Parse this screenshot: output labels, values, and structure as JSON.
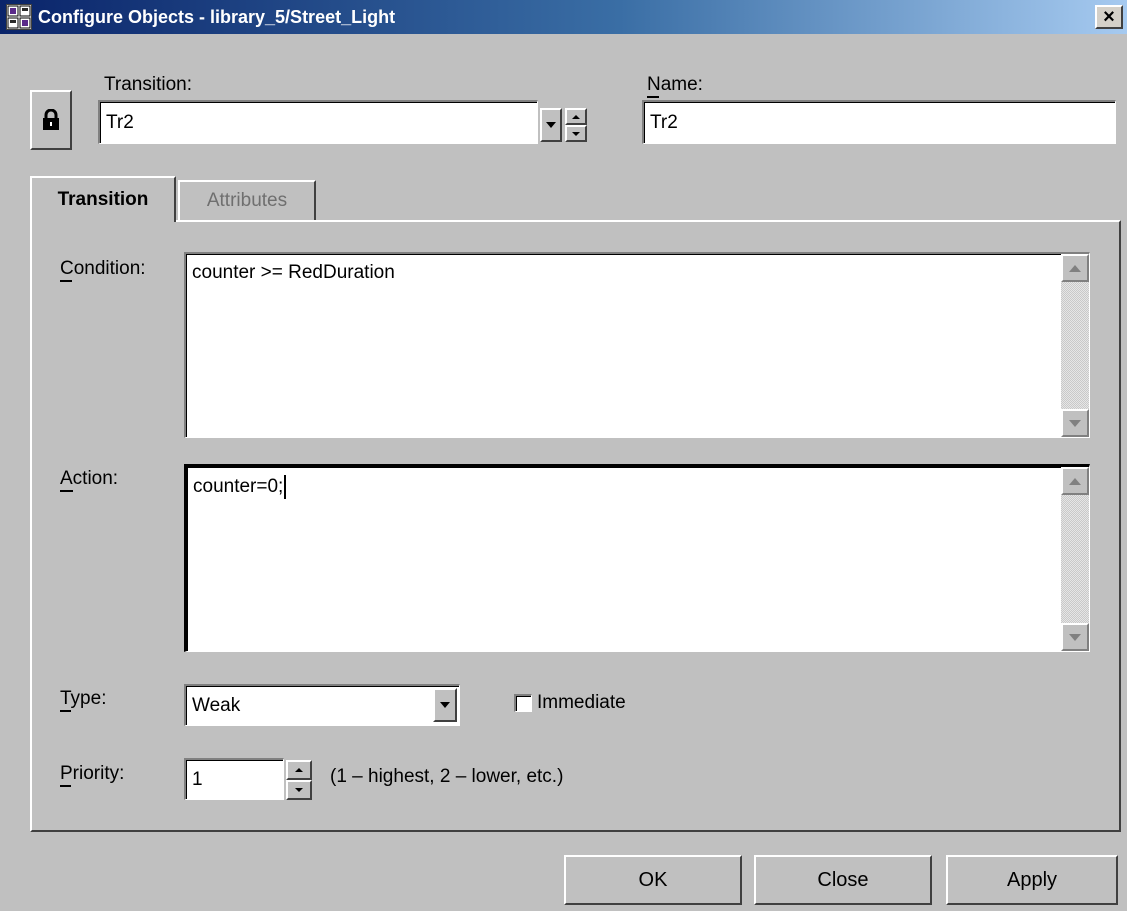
{
  "window": {
    "title": "Configure Objects - library_5/Street_Light",
    "close_glyph": "×"
  },
  "header": {
    "transition_label": "Transition:",
    "transition_value": "Tr2",
    "name_label": "Name:",
    "name_value": "Tr2"
  },
  "tabs": [
    {
      "label": "Transition",
      "active": true
    },
    {
      "label": "Attributes",
      "active": false
    }
  ],
  "condition": {
    "label": "Condition:",
    "value": "counter >= RedDuration"
  },
  "action": {
    "label": "Action:",
    "value": "counter=0;"
  },
  "type": {
    "label": "Type:",
    "value": "Weak"
  },
  "immediate": {
    "label": "Immediate",
    "checked": false
  },
  "priority": {
    "label": "Priority:",
    "value": "1",
    "hint": "(1 – highest, 2 – lower, etc.)"
  },
  "buttons": {
    "ok": "OK",
    "close": "Close",
    "apply": "Apply"
  },
  "colors": {
    "dialog_bg": "#c0c0c0",
    "titlebar_start": "#0a246a",
    "titlebar_end": "#a6caf0"
  },
  "icons": {
    "app": "grid-app-icon",
    "lock": "lock-icon"
  }
}
